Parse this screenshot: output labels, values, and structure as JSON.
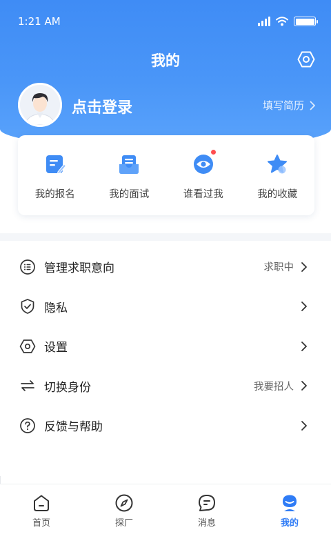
{
  "status_bar": {
    "time": "1:21 AM",
    "battery_level": 1.0
  },
  "header": {
    "title": "我的"
  },
  "profile": {
    "login_text": "点击登录",
    "resume_link": "填写简历"
  },
  "quick_actions": [
    {
      "label": "我的报名",
      "icon": "edit-document-icon",
      "badge": false
    },
    {
      "label": "我的面试",
      "icon": "inbox-icon",
      "badge": false
    },
    {
      "label": "谁看过我",
      "icon": "eye-icon",
      "badge": true
    },
    {
      "label": "我的收藏",
      "icon": "star-icon",
      "badge": false
    }
  ],
  "menu": [
    {
      "label": "管理求职意向",
      "value": "求职中",
      "icon": "list-icon"
    },
    {
      "label": "隐私",
      "value": "",
      "icon": "shield-check-icon"
    },
    {
      "label": "设置",
      "value": "",
      "icon": "gear-hexagon-icon"
    },
    {
      "label": "切换身份",
      "value": "我要招人",
      "icon": "swap-arrows-icon"
    },
    {
      "label": "反馈与帮助",
      "value": "",
      "icon": "help-circle-icon"
    }
  ],
  "tabs": [
    {
      "label": "首页",
      "icon": "home-icon",
      "active": false
    },
    {
      "label": "探厂",
      "icon": "compass-icon",
      "active": false
    },
    {
      "label": "消息",
      "icon": "message-icon",
      "active": false
    },
    {
      "label": "我的",
      "icon": "profile-icon",
      "active": true
    }
  ],
  "colors": {
    "brand_blue": "#3f8cf5",
    "active_tab": "#2f7cf6",
    "badge_red": "#ff4d4f"
  }
}
